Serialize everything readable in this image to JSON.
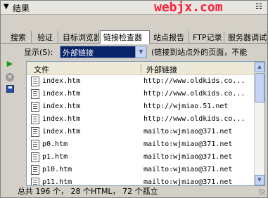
{
  "title_bar": {
    "collapse_glyph": "▼",
    "title": "结果",
    "watermark": "webjx.com",
    "options_glyph": "☷"
  },
  "tabs": [
    {
      "label": "搜索",
      "active": false
    },
    {
      "label": "验证",
      "active": false
    },
    {
      "label": "目标浏览器",
      "active": false
    },
    {
      "label": "链接检查器",
      "active": true
    },
    {
      "label": "站点报告",
      "active": false
    },
    {
      "label": "FTP记录",
      "active": false
    },
    {
      "label": "服务器调试",
      "active": false
    }
  ],
  "show": {
    "label": "显示(S):",
    "selected": "外部链接",
    "description": "(链接到站点外的页面，不能"
  },
  "side_buttons": {
    "run_icon": "▶",
    "stop_icon": "×"
  },
  "list": {
    "columns": [
      "文件",
      "外部链接"
    ],
    "rows": [
      {
        "file": "index.htm",
        "link": "http://www.oldkids.co..."
      },
      {
        "file": "index.htm",
        "link": "http://www.oldkids.co..."
      },
      {
        "file": "index.htm",
        "link": "http://wjmiao.51.net"
      },
      {
        "file": "index.htm",
        "link": "http://www.oldkids.co..."
      },
      {
        "file": "index.htm",
        "link": "mailto:wjmiao@371.net"
      },
      {
        "file": "p0.htm",
        "link": "mailto:wjmiao@371.net"
      },
      {
        "file": "p1.htm",
        "link": "mailto:wjmiao@371.net"
      },
      {
        "file": "p10.htm",
        "link": "mailto:wjmiao@371.net"
      },
      {
        "file": "p11.htm",
        "link": "mailto:wjmiao@371.net"
      }
    ]
  },
  "status": {
    "text": "总共 196 个， 28 个HTML， 72 个孤立"
  },
  "colors": {
    "panel": "#d4d0c8",
    "watermark": "#ff1f3a",
    "select_highlight": "#0a246a",
    "run_icon": "#1a9a1a"
  }
}
